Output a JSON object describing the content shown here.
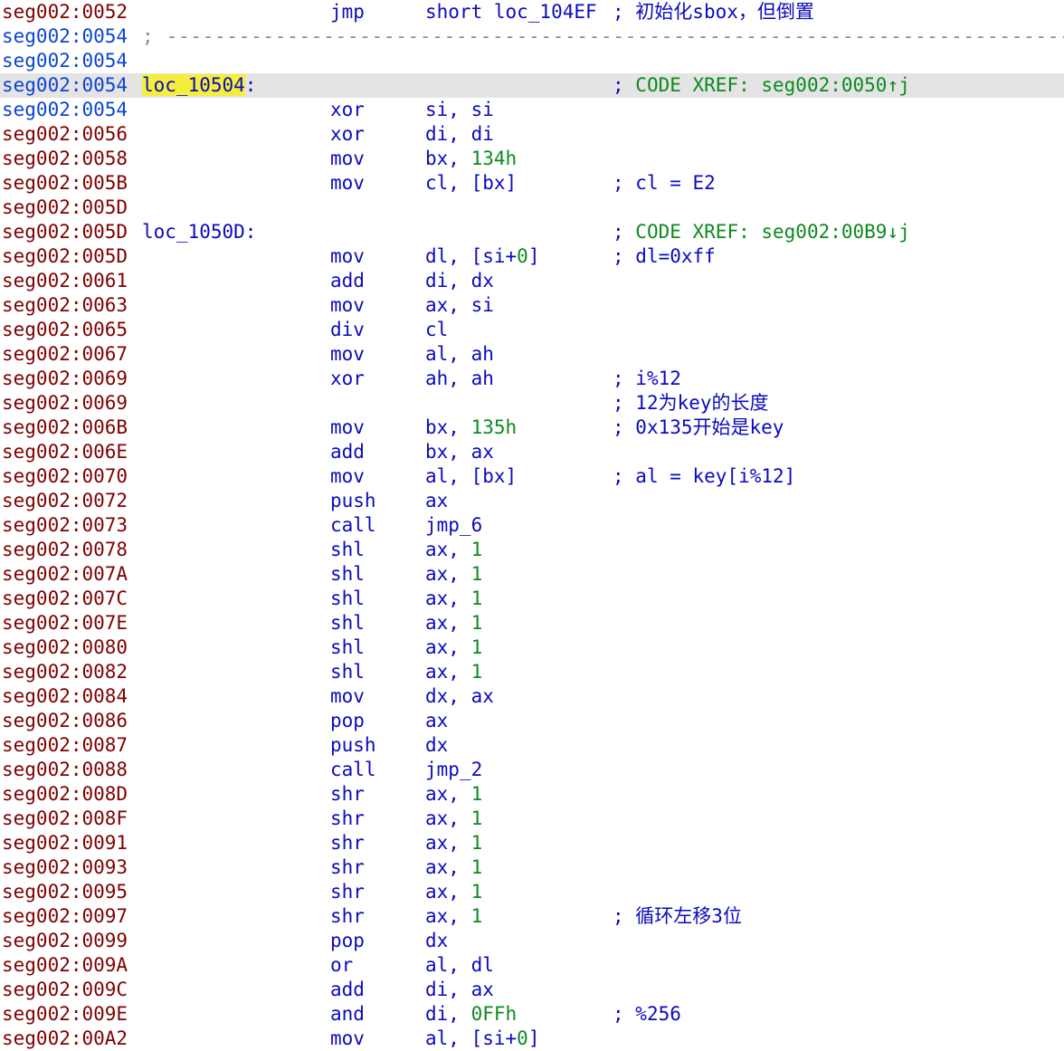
{
  "view": "IDA View",
  "lines": [
    {
      "addr": "seg002:0052",
      "addr_style": "code",
      "mnemonic": "jmp",
      "operands": "short loc_104EF",
      "comment": "初始化sbox，但倒置"
    },
    {
      "addr": "seg002:0054",
      "addr_style": "other",
      "separator": "; ----------------------------------------------------------------------------"
    },
    {
      "addr": "seg002:0054",
      "addr_style": "other"
    },
    {
      "addr": "seg002:0054",
      "addr_style": "other",
      "highlight": true,
      "label": "loc_10504",
      "label_selected": true,
      "xref": "CODE XREF: seg002:0050↑j"
    },
    {
      "addr": "seg002:0054",
      "addr_style": "other",
      "mnemonic": "xor",
      "operands": "si, si"
    },
    {
      "addr": "seg002:0056",
      "addr_style": "code",
      "mnemonic": "xor",
      "operands": "di, di"
    },
    {
      "addr": "seg002:0058",
      "addr_style": "code",
      "mnemonic": "mov",
      "operands": "bx, ",
      "number": "134h"
    },
    {
      "addr": "seg002:005B",
      "addr_style": "code",
      "mnemonic": "mov",
      "operands": "cl, [bx]",
      "comment": "cl = E2"
    },
    {
      "addr": "seg002:005D",
      "addr_style": "code"
    },
    {
      "addr": "seg002:005D",
      "addr_style": "code",
      "label": "loc_1050D",
      "xref": "CODE XREF: seg002:00B9↓j"
    },
    {
      "addr": "seg002:005D",
      "addr_style": "code",
      "mnemonic": "mov",
      "operands": "dl, [si+",
      "number": "0",
      "operands_tail": "]",
      "comment": "dl=0xff"
    },
    {
      "addr": "seg002:0061",
      "addr_style": "code",
      "mnemonic": "add",
      "operands": "di, dx"
    },
    {
      "addr": "seg002:0063",
      "addr_style": "code",
      "mnemonic": "mov",
      "operands": "ax, si"
    },
    {
      "addr": "seg002:0065",
      "addr_style": "code",
      "mnemonic": "div",
      "operands": "cl"
    },
    {
      "addr": "seg002:0067",
      "addr_style": "code",
      "mnemonic": "mov",
      "operands": "al, ah"
    },
    {
      "addr": "seg002:0069",
      "addr_style": "code",
      "mnemonic": "xor",
      "operands": "ah, ah",
      "comment": "i%12"
    },
    {
      "addr": "seg002:0069",
      "addr_style": "code",
      "comment": "12为key的长度"
    },
    {
      "addr": "seg002:006B",
      "addr_style": "code",
      "mnemonic": "mov",
      "operands": "bx, ",
      "number": "135h",
      "comment": "0x135开始是key"
    },
    {
      "addr": "seg002:006E",
      "addr_style": "code",
      "mnemonic": "add",
      "operands": "bx, ax"
    },
    {
      "addr": "seg002:0070",
      "addr_style": "code",
      "mnemonic": "mov",
      "operands": "al, [bx]",
      "comment": "al = key[i%12]"
    },
    {
      "addr": "seg002:0072",
      "addr_style": "code",
      "mnemonic": "push",
      "operands": "ax"
    },
    {
      "addr": "seg002:0073",
      "addr_style": "code",
      "mnemonic": "call",
      "operands": "jmp_6"
    },
    {
      "addr": "seg002:0078",
      "addr_style": "code",
      "mnemonic": "shl",
      "operands": "ax, ",
      "number": "1"
    },
    {
      "addr": "seg002:007A",
      "addr_style": "code",
      "mnemonic": "shl",
      "operands": "ax, ",
      "number": "1"
    },
    {
      "addr": "seg002:007C",
      "addr_style": "code",
      "mnemonic": "shl",
      "operands": "ax, ",
      "number": "1"
    },
    {
      "addr": "seg002:007E",
      "addr_style": "code",
      "mnemonic": "shl",
      "operands": "ax, ",
      "number": "1"
    },
    {
      "addr": "seg002:0080",
      "addr_style": "code",
      "mnemonic": "shl",
      "operands": "ax, ",
      "number": "1"
    },
    {
      "addr": "seg002:0082",
      "addr_style": "code",
      "mnemonic": "shl",
      "operands": "ax, ",
      "number": "1"
    },
    {
      "addr": "seg002:0084",
      "addr_style": "code",
      "mnemonic": "mov",
      "operands": "dx, ax"
    },
    {
      "addr": "seg002:0086",
      "addr_style": "code",
      "mnemonic": "pop",
      "operands": "ax"
    },
    {
      "addr": "seg002:0087",
      "addr_style": "code",
      "mnemonic": "push",
      "operands": "dx"
    },
    {
      "addr": "seg002:0088",
      "addr_style": "code",
      "mnemonic": "call",
      "operands": "jmp_2"
    },
    {
      "addr": "seg002:008D",
      "addr_style": "code",
      "mnemonic": "shr",
      "operands": "ax, ",
      "number": "1"
    },
    {
      "addr": "seg002:008F",
      "addr_style": "code",
      "mnemonic": "shr",
      "operands": "ax, ",
      "number": "1"
    },
    {
      "addr": "seg002:0091",
      "addr_style": "code",
      "mnemonic": "shr",
      "operands": "ax, ",
      "number": "1"
    },
    {
      "addr": "seg002:0093",
      "addr_style": "code",
      "mnemonic": "shr",
      "operands": "ax, ",
      "number": "1"
    },
    {
      "addr": "seg002:0095",
      "addr_style": "code",
      "mnemonic": "shr",
      "operands": "ax, ",
      "number": "1"
    },
    {
      "addr": "seg002:0097",
      "addr_style": "code",
      "mnemonic": "shr",
      "operands": "ax, ",
      "number": "1",
      "comment": "循环左移3位"
    },
    {
      "addr": "seg002:0099",
      "addr_style": "code",
      "mnemonic": "pop",
      "operands": "dx"
    },
    {
      "addr": "seg002:009A",
      "addr_style": "code",
      "mnemonic": "or",
      "operands": "al, dl"
    },
    {
      "addr": "seg002:009C",
      "addr_style": "code",
      "mnemonic": "add",
      "operands": "di, ax"
    },
    {
      "addr": "seg002:009E",
      "addr_style": "code",
      "mnemonic": "and",
      "operands": "di, ",
      "number": "0FFh",
      "comment": "%256"
    },
    {
      "addr": "seg002:00A2",
      "addr_style": "code",
      "mnemonic": "mov",
      "operands": "al, [si+",
      "number": "0",
      "operands_tail": "]"
    }
  ]
}
